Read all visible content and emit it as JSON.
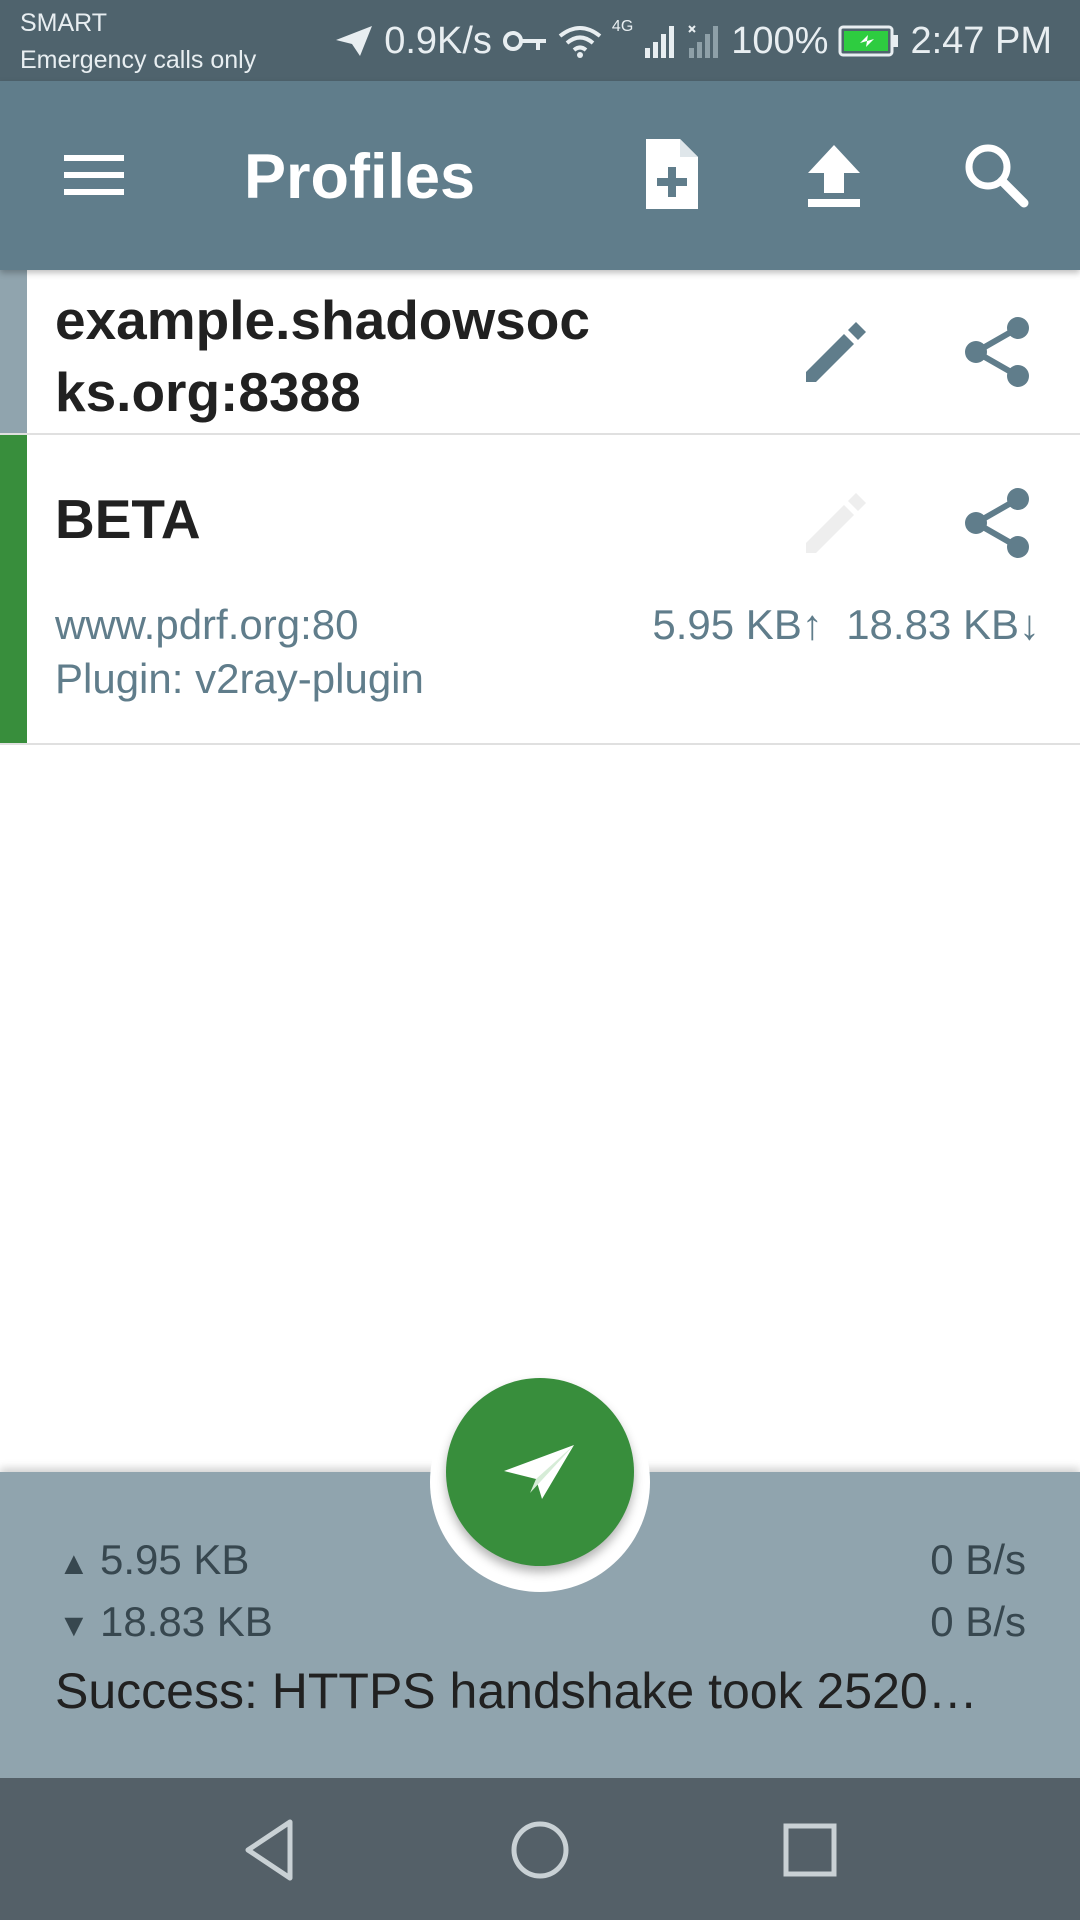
{
  "status_bar": {
    "carrier": "SMART",
    "emergency": "Emergency calls only",
    "speed": "0.9K/s",
    "network": "4G",
    "battery": "100%",
    "time": "2:47 PM"
  },
  "app_bar": {
    "title": "Profiles",
    "icons": [
      "menu-icon",
      "add-file-icon",
      "upload-icon",
      "search-icon"
    ]
  },
  "profiles": [
    {
      "name": "example.shadowsocks.org:8388",
      "selected": false,
      "edit_enabled": true
    },
    {
      "name": "BETA",
      "host": "www.pdrf.org:80",
      "plugin": "Plugin: v2ray-plugin",
      "traffic_up": "5.95 KB↑",
      "traffic_down": "18.83 KB↓",
      "selected": true,
      "edit_enabled": false
    }
  ],
  "stats": {
    "up_total": "5.95 KB",
    "down_total": "18.83 KB",
    "up_rate": "0 B/s",
    "down_rate": "0 B/s",
    "message": "Success: HTTPS handshake took 2520…"
  },
  "colors": {
    "status_bar": "#4f636d",
    "app_bar": "#607d8b",
    "accent_green": "#388e3c",
    "panel": "#90a4ae",
    "nav_bar": "#546068"
  }
}
